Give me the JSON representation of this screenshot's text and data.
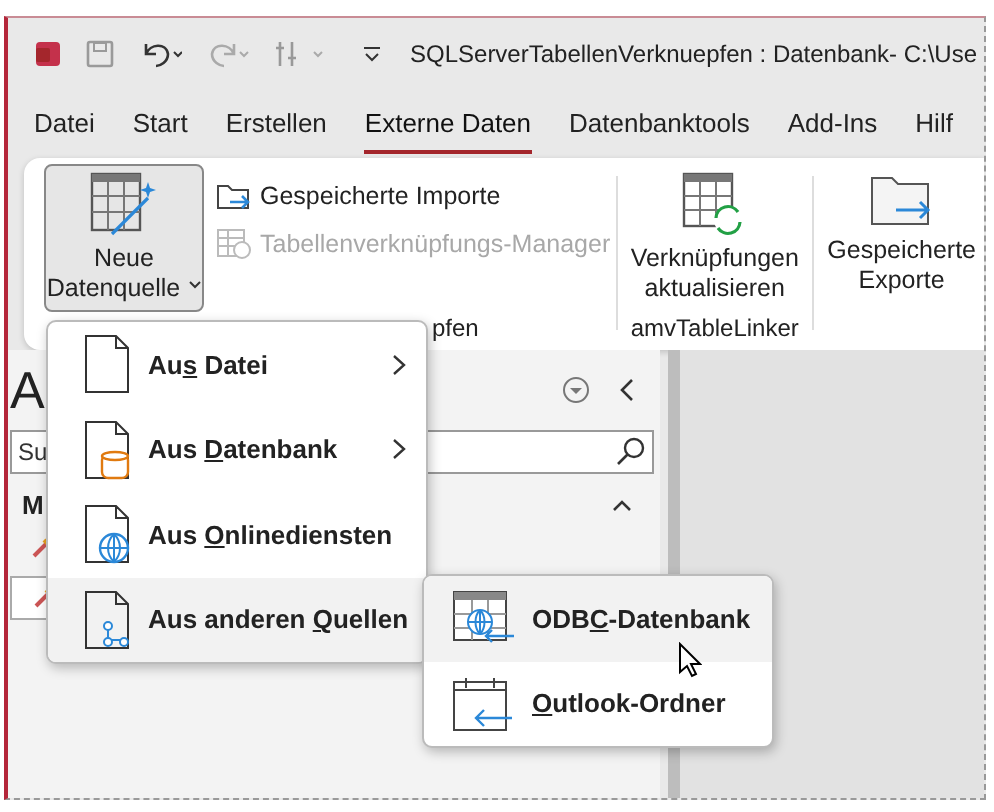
{
  "title_bar": {
    "title": "SQLServerTabellenVerknuepfen : Datenbank- C:\\Use"
  },
  "tabs": [
    {
      "label": "Datei",
      "selected": false
    },
    {
      "label": "Start",
      "selected": false
    },
    {
      "label": "Erstellen",
      "selected": false
    },
    {
      "label": "Externe Daten",
      "selected": true
    },
    {
      "label": "Datenbanktools",
      "selected": false
    },
    {
      "label": "Add-Ins",
      "selected": false
    },
    {
      "label": "Hilf",
      "selected": false
    }
  ],
  "ribbon": {
    "new_source_button": {
      "label_1": "Neue",
      "label_2": "Datenquelle",
      "expanded": true
    },
    "import_commands": [
      {
        "label": "Gespeicherte Importe",
        "disabled": false
      },
      {
        "label": "Tabellenverknüpfungs-Manager",
        "disabled": true
      }
    ],
    "group_label_1": "pfen",
    "refresh_button": {
      "label_1": "Verknüpfungen",
      "label_2": "aktualisieren"
    },
    "group_label_2": "amvTableLinker",
    "export_button": {
      "label_1": "Gespeicherte",
      "label_2": "Exporte"
    }
  },
  "nav_pane": {
    "title": "A",
    "search": {
      "placeholder": "Su"
    },
    "group": "M"
  },
  "menu": {
    "items": [
      {
        "before": "Au",
        "key": "s",
        "after": " Datei",
        "highlighted": false
      },
      {
        "before": "Aus ",
        "key": "D",
        "after": "atenbank",
        "highlighted": false
      },
      {
        "before": "Aus ",
        "key": "O",
        "after": "nlinediensten",
        "highlighted": false
      },
      {
        "before": "Aus anderen ",
        "key": "Q",
        "after": "uellen",
        "highlighted": true
      }
    ]
  },
  "submenu": {
    "items": [
      {
        "before": "ODB",
        "key": "C",
        "after": "-Datenbank",
        "highlighted": true
      },
      {
        "key": "O",
        "after": "utlook-Ordner",
        "highlighted": false
      }
    ]
  }
}
